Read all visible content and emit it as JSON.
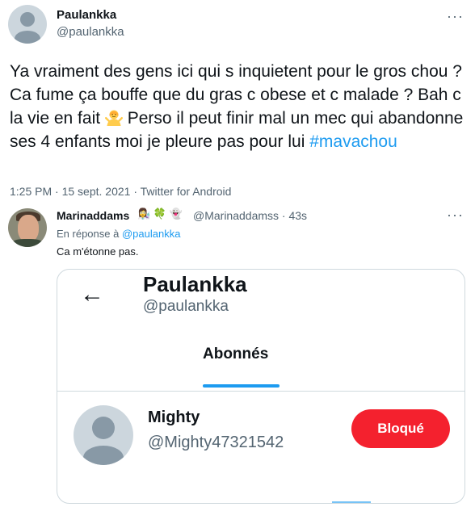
{
  "main_tweet": {
    "name": "Paulankka",
    "handle": "@paulankka",
    "text_before_emoji": "Ya vraiment des gens ici qui s inquietent pour le gros chou ? Ca fume ça bouffe que du gras c obese et c malade ? Bah c la vie en fait ",
    "text_after_emoji": " Perso il peut finir mal un mec qui abandonne ses 4 enfants moi je pleure pas pour lui ",
    "hashtag": "#mavachou",
    "meta": "1:25 PM · 15 sept. 2021 · Twitter for Android",
    "emoji_icon": "woman-shrugging-emoji"
  },
  "reply": {
    "name": "Marinaddams",
    "badges": "👩‍🔬 🍀 👻",
    "handle_time": "@Marinaddamss · 43s",
    "in_reply_prefix": "En réponse à ",
    "in_reply_handle": "@paulankka",
    "text": "Ca m'étonne pas."
  },
  "embedded_card": {
    "back_icon": "back-arrow-icon",
    "back_glyph": "←",
    "profile_name": "Paulankka",
    "profile_handle": "@paulankka",
    "tab_label": "Abonnés",
    "user_name": "Mighty",
    "user_handle": "@Mighty47321542",
    "blocked_label": "Bloqué"
  },
  "more_glyph": "···",
  "colors": {
    "link": "#1d9bf0",
    "blocked_button": "#f4212e",
    "secondary_text": "#536471"
  }
}
